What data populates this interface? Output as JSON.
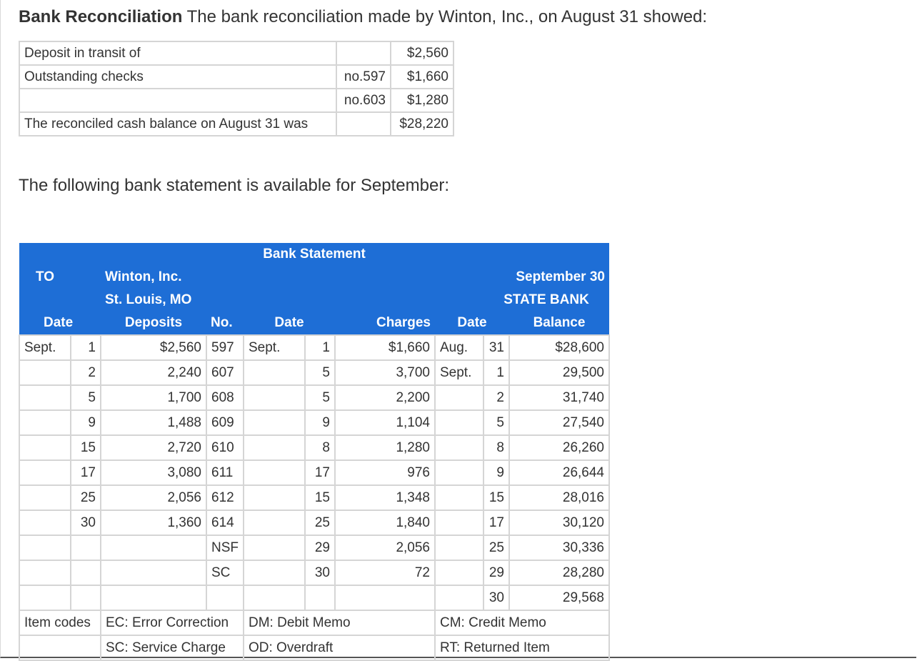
{
  "heading": {
    "bold": "Bank Reconciliation",
    "text": " The bank reconciliation made by Winton, Inc., on August 31 showed:"
  },
  "reconciliation": {
    "rows": [
      {
        "label": "Deposit in transit of",
        "ref": "",
        "amount": "$2,560"
      },
      {
        "label": "Outstanding checks",
        "ref": "no.597",
        "amount": "$1,660"
      },
      {
        "label": "",
        "ref": "no.603",
        "amount": "$1,280"
      },
      {
        "label": "The reconciled cash balance on August 31 was",
        "ref": "",
        "amount": "$28,220"
      }
    ]
  },
  "subtext": "The following bank statement is available for September:",
  "statement": {
    "title": "Bank Statement",
    "to_label": "TO",
    "company": "Winton, Inc.",
    "location": "St. Louis, MO",
    "date_label": "September 30",
    "bank_name": "STATE BANK",
    "columns": [
      "Date",
      "Deposits",
      "No.",
      "Date",
      "Charges",
      "Date",
      "Balance"
    ],
    "rows": [
      [
        "Sept.",
        "1",
        "$2,560",
        "597",
        "Sept.",
        "1",
        "$1,660",
        "Aug.",
        "31",
        "$28,600"
      ],
      [
        "",
        "2",
        "2,240",
        "607",
        "",
        "5",
        "3,700",
        "Sept.",
        "1",
        "29,500"
      ],
      [
        "",
        "5",
        "1,700",
        "608",
        "",
        "5",
        "2,200",
        "",
        "2",
        "31,740"
      ],
      [
        "",
        "9",
        "1,488",
        "609",
        "",
        "9",
        "1,104",
        "",
        "5",
        "27,540"
      ],
      [
        "",
        "15",
        "2,720",
        "610",
        "",
        "8",
        "1,280",
        "",
        "8",
        "26,260"
      ],
      [
        "",
        "17",
        "3,080",
        "611",
        "",
        "17",
        "976",
        "",
        "9",
        "26,644"
      ],
      [
        "",
        "25",
        "2,056",
        "612",
        "",
        "15",
        "1,348",
        "",
        "15",
        "28,016"
      ],
      [
        "",
        "30",
        "1,360",
        "614",
        "",
        "25",
        "1,840",
        "",
        "17",
        "30,120"
      ],
      [
        "",
        "",
        "",
        "NSF",
        "",
        "29",
        "2,056",
        "",
        "25",
        "30,336"
      ],
      [
        "",
        "",
        "",
        "SC",
        "",
        "30",
        "72",
        "",
        "29",
        "28,280"
      ],
      [
        "",
        "",
        "",
        "",
        "",
        "",
        "",
        "",
        "30",
        "29,568"
      ]
    ],
    "item_codes": {
      "label": "Item codes",
      "ec": "EC: Error Correction",
      "dm": "DM: Debit Memo",
      "cm": "CM: Credit Memo",
      "sc": "SC: Service Charge",
      "od": "OD: Overdraft",
      "rt": "RT: Returned Item"
    }
  }
}
